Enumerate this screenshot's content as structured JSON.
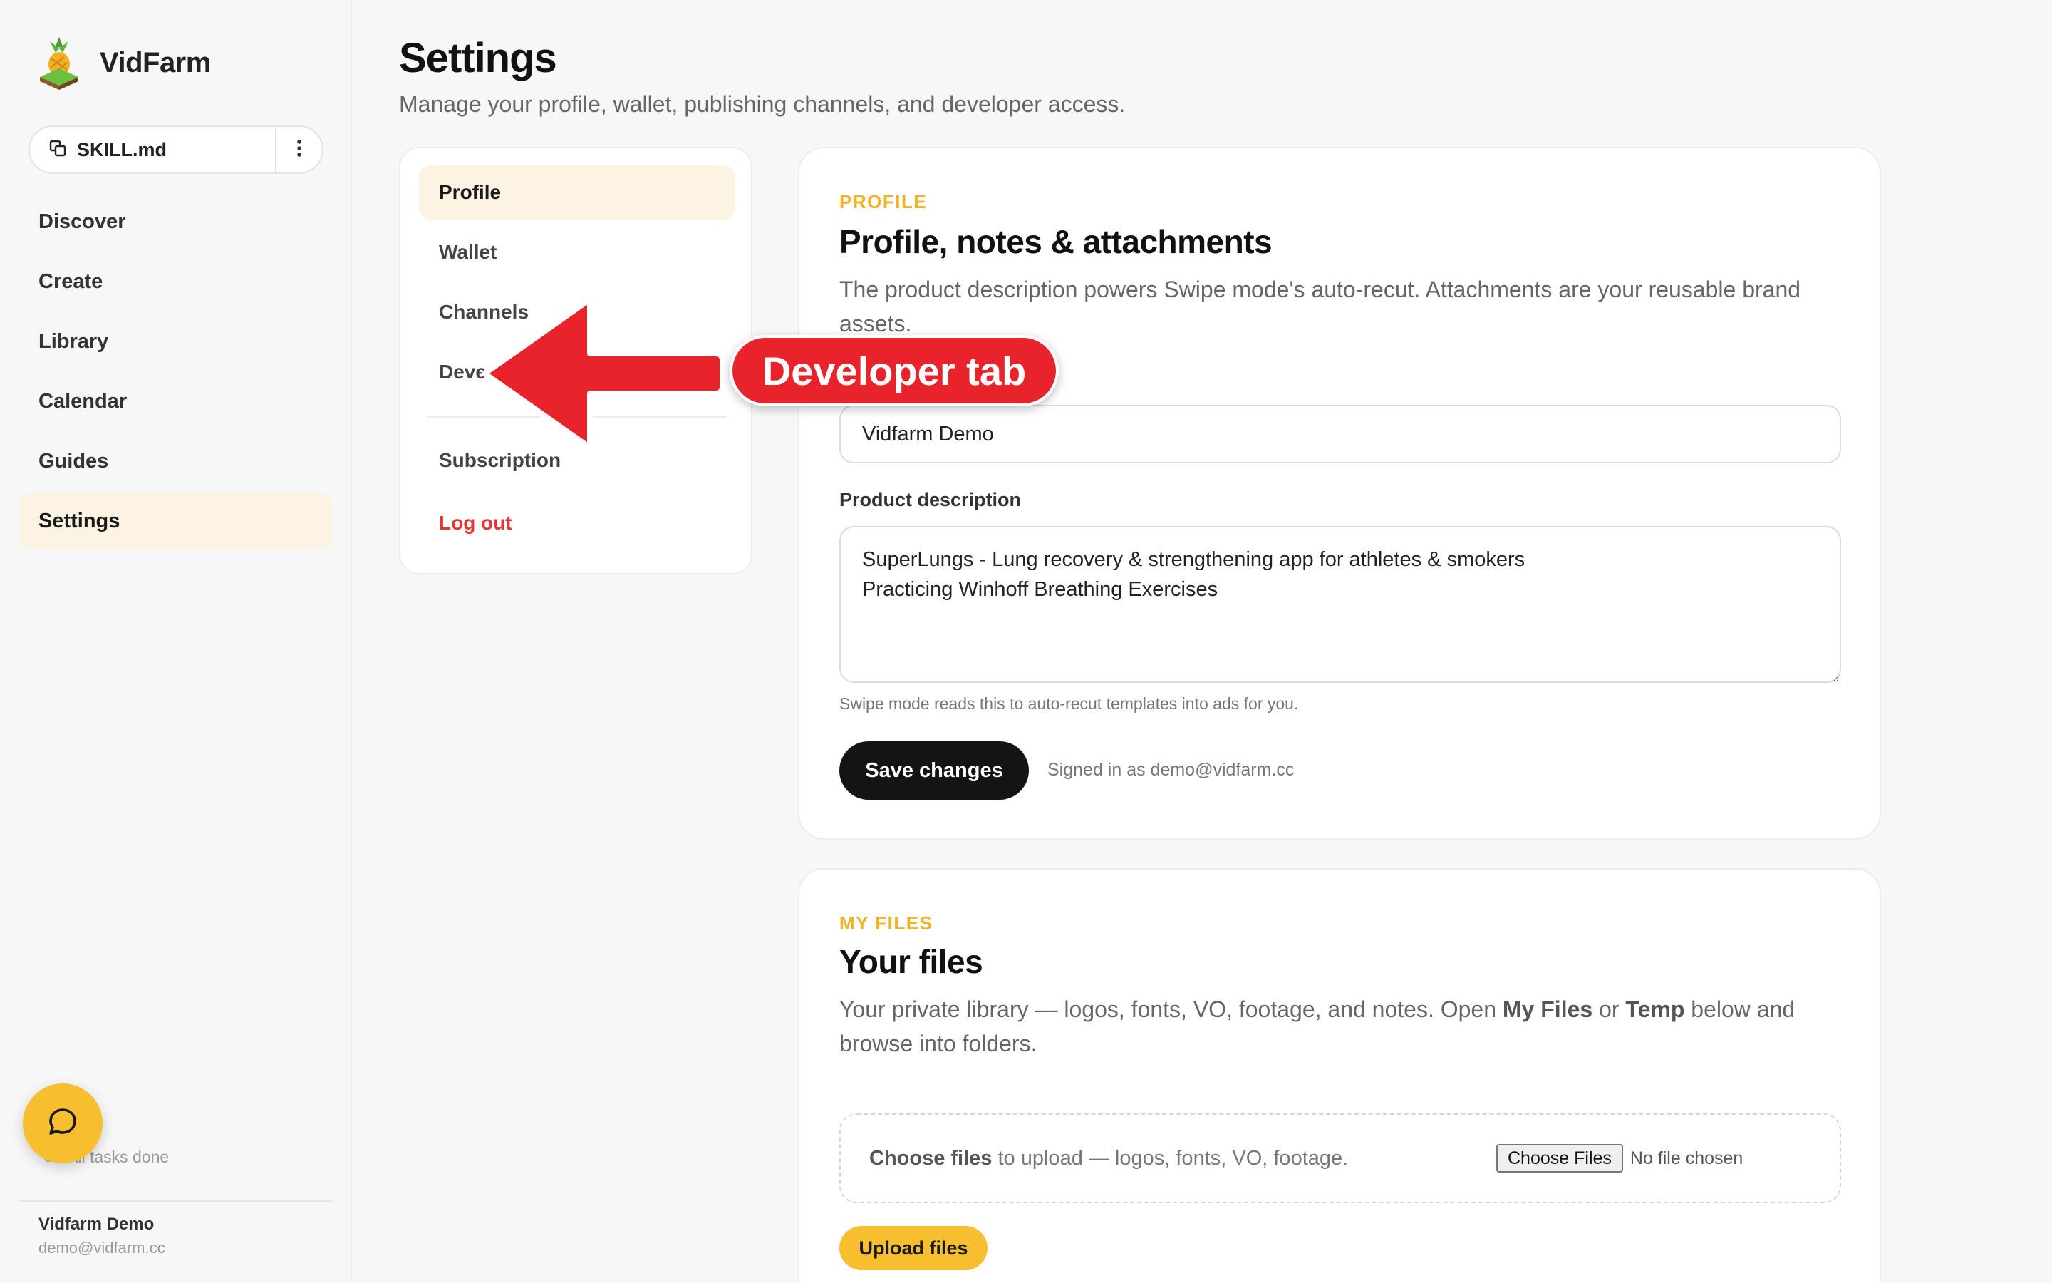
{
  "brand": {
    "name": "VidFarm"
  },
  "skill": {
    "label": "SKILL.md"
  },
  "sidebar": {
    "items": [
      {
        "label": "Discover"
      },
      {
        "label": "Create"
      },
      {
        "label": "Library"
      },
      {
        "label": "Calendar"
      },
      {
        "label": "Guides"
      },
      {
        "label": "Settings"
      }
    ],
    "active": "Settings",
    "tasks_label": "All tasks done"
  },
  "user": {
    "name": "Vidfarm Demo",
    "email": "demo@vidfarm.cc"
  },
  "header": {
    "title": "Settings",
    "subtitle": "Manage your profile, wallet, publishing channels, and developer access."
  },
  "settings_tabs": {
    "items": [
      {
        "label": "Profile"
      },
      {
        "label": "Wallet"
      },
      {
        "label": "Channels"
      },
      {
        "label": "Deve"
      },
      {
        "label": "Subscription"
      },
      {
        "label": "Log out"
      }
    ],
    "active": "Profile"
  },
  "profile_card": {
    "eyebrow": "PROFILE",
    "title": "Profile, notes & attachments",
    "description": "The product description powers Swipe mode's auto-recut. Attachments are your reusable brand assets.",
    "name_value": "Vidfarm Demo",
    "product_label": "Product description",
    "product_value": "SuperLungs - Lung recovery & strengthening app for athletes & smokers\nPracticing Winhoff Breathing Exercises",
    "hint": "Swipe mode reads this to auto-recut templates into ads for you.",
    "save_label": "Save changes",
    "signed_in": "Signed in as demo@vidfarm.cc"
  },
  "files_card": {
    "eyebrow": "MY FILES",
    "title": "Your files",
    "desc_part1": "Your private library — logos, fonts, VO, footage, and notes. Open ",
    "desc_bold1": "My Files",
    "desc_part2": " or ",
    "desc_bold2": "Temp",
    "desc_part3": " below and browse into folders.",
    "drop_bold": "Choose files",
    "drop_rest": " to upload — logos, fonts, VO, footage.",
    "choose_label": "Choose Files",
    "no_file": "No file chosen",
    "upload_label": "Upload files"
  },
  "annotation": {
    "label": "Developer tab",
    "color": "#e8232b"
  },
  "colors": {
    "accent": "#f7bf2f",
    "eyebrow": "#f2b125",
    "active_bg": "#fdf3e2",
    "danger": "#e53535"
  }
}
